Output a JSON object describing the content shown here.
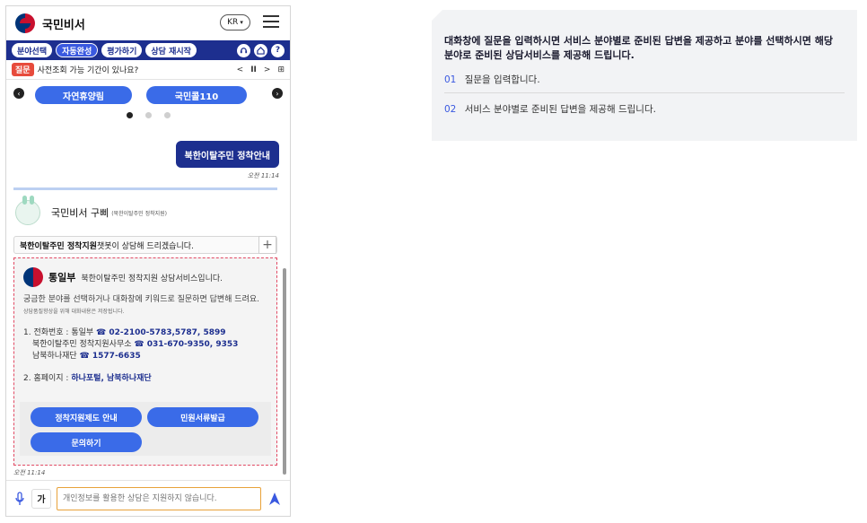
{
  "header": {
    "app_title": "국민비서",
    "lang": "KR",
    "lang_icon": "chevron-down-icon",
    "menu_icon": "hamburger-icon"
  },
  "nav": {
    "items": [
      "분야선택",
      "자동완성",
      "평가하기",
      "상담 재시작"
    ],
    "active_index": 1,
    "icons": [
      "headset-icon",
      "home-icon",
      "help-icon"
    ],
    "help_glyph": "?"
  },
  "question_bar": {
    "tag": "질문",
    "text": "사전조회 가능 기간이 있나요?",
    "prev": "<",
    "pause": "II",
    "next": ">",
    "expand": "⊞"
  },
  "carousel": {
    "buttons": [
      "자연휴양림",
      "국민콜110"
    ],
    "dots": 3,
    "active_dot": 0
  },
  "user_message": {
    "text": "북한이탈주민 정착안내",
    "time": "오전 11:14"
  },
  "bot": {
    "name": "국민비서 구삐",
    "sub": "(북한이탈주민 정착지원)",
    "info_bold": "북한이탈주민 정착지원",
    "info_text": " 챗봇이 상담해 드리겠습니다.",
    "plus": "+"
  },
  "card": {
    "org": "통일부",
    "org_desc": "북한이탈주민 정착지원 상담서비스입니다.",
    "body": "궁금한 분야를 선택하거나 대화창에 키워드로 질문하면 답변해 드려요.",
    "note": "상담품질향상을 위해 대화내용은 저장됩니다.",
    "contact_label": "1. 전화번호 : 통일부 ",
    "contact_1": "☎ 02-2100-5783,5787, 5899",
    "contact_2_label": "북한이탈주민 정착지원사무소 ",
    "contact_2": "☎ 031-670-9350, 9353",
    "contact_3_label": "남북하나재단 ",
    "contact_3": "☎ 1577-6635",
    "home_label": "2. 홈페이지 : ",
    "home_value": "하나포털, 남북하나재단",
    "buttons": [
      "정착지원제도 안내",
      "민원서류발급",
      "문의하기"
    ],
    "time": "오전 11:14"
  },
  "input": {
    "mode": "가",
    "placeholder": "개인정보를 활용한 상담은 지원하지 않습니다.",
    "mic_icon": "microphone-icon",
    "send_icon": "send-icon"
  },
  "panel": {
    "title": "대화창에 질문을 입력하시면 서비스 분야별로 준비된 답변을 제공하고 분야를 선택하시면 해당 분야로 준비된 상담서비스를 제공해 드립니다.",
    "steps": [
      {
        "num": "01",
        "text": "질문을 입력합니다."
      },
      {
        "num": "02",
        "text": "서비스 분야별로 준비된 답변을 제공해 드립니다."
      }
    ]
  }
}
